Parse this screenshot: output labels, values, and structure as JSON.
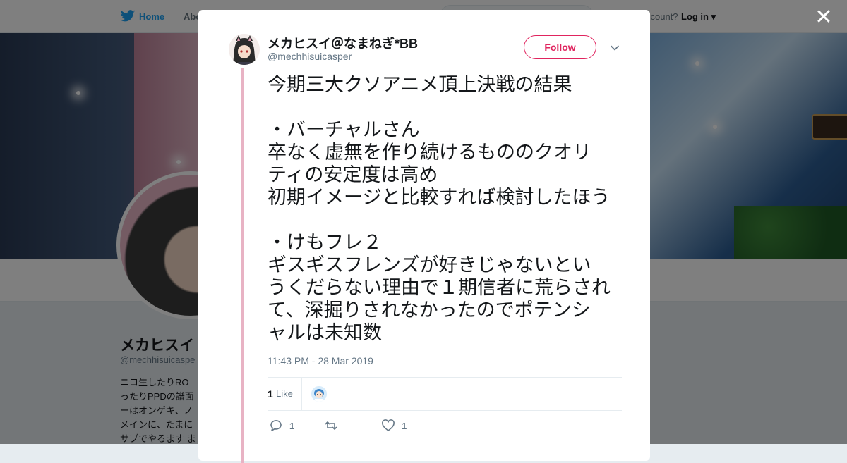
{
  "nav": {
    "home": "Home",
    "about": "Abo",
    "account": "ccount?",
    "login": "Log in"
  },
  "profile": {
    "name": "メカヒスイ",
    "handle": "@mechhisuicaspe",
    "bio": "ニコ生したりRO\nったりPPDの譜面\nーはオンゲキ、ノ\nメインに、たまに\nサブでやるます ま"
  },
  "tweet": {
    "name": "メカヒスイ＠なまねぎ*BB",
    "handle": "@mechhisuicasper",
    "follow_label": "Follow",
    "text": "今期三大クソアニメ頂上決戦の結果\n\n・バーチャルさん\n卒なく虚無を作り続けるもののクオリ\nティの安定度は高め\n初期イメージと比較すれば検討したほう\n\n・けもフレ２\nギスギスフレンズが好きじゃないとい\nうくだらない理由で１期信者に荒らされ\nて、深掘りされなかったのでポテンシ\nャルは未知数",
    "timestamp": "11:43 PM - 28 Mar 2019",
    "likes_count": "1",
    "likes_label": "Like",
    "reply_count": "1",
    "retweet_count": "",
    "like_action_count": "1"
  },
  "colors": {
    "accent": "#e0245e",
    "link": "#1da1f2",
    "thread": "#e8b3c4",
    "muted": "#657786"
  },
  "icons": [
    "twitter-logo-icon",
    "chevron-down-icon",
    "close-icon",
    "reply-icon",
    "retweet-icon",
    "heart-icon"
  ]
}
